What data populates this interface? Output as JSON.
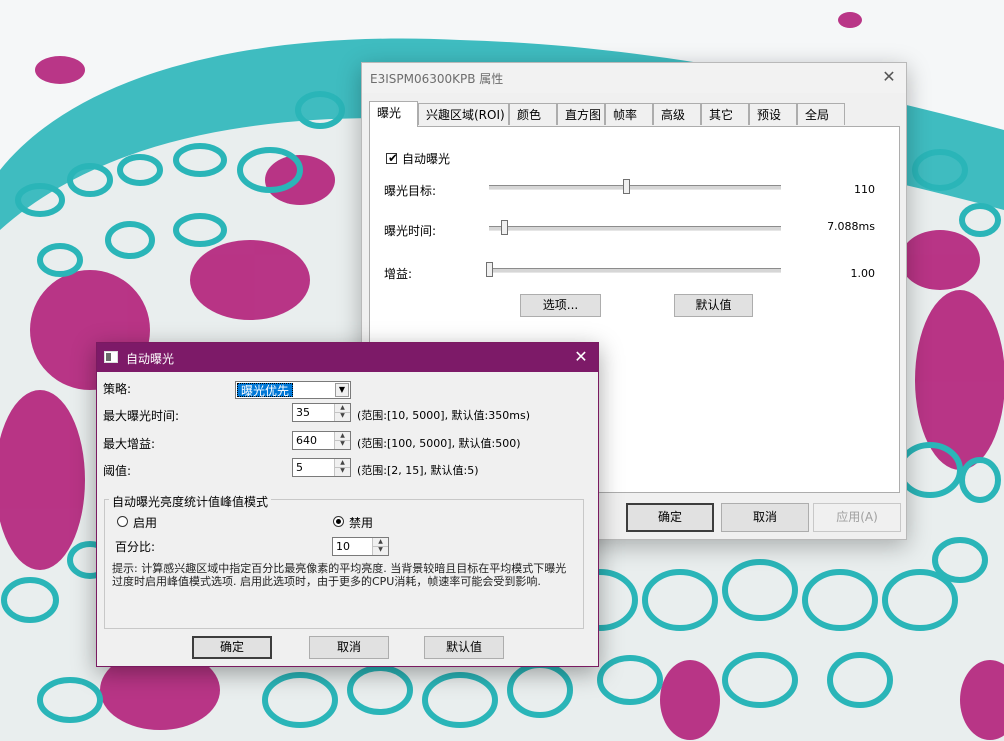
{
  "props_window": {
    "title": "E3ISPM06300KPB 属性",
    "close_glyph": "✕",
    "tabs": [
      "曝光",
      "兴趣区域(ROI)",
      "颜色",
      "直方图",
      "帧率",
      "高级",
      "其它",
      "预设",
      "全局"
    ],
    "active_tab": "曝光",
    "auto_exposure_label": "自动曝光",
    "auto_exposure_checked": true,
    "check_glyph": "✔",
    "target_label": "曝光目标:",
    "target_value": "110",
    "target_position": 0.47,
    "time_label": "曝光时间:",
    "time_value": "7.088ms",
    "time_position": 0.05,
    "gain_label": "增益:",
    "gain_value": "1.00",
    "gain_position": 0.0,
    "options_button": "选项...",
    "defaults_button": "默认值",
    "ok_button": "确定",
    "cancel_button": "取消",
    "apply_button": "应用(A)"
  },
  "ae_dialog": {
    "title": "自动曝光",
    "close_glyph": "✕",
    "strategy_label": "策略:",
    "strategy_value": "曝光优先",
    "max_time_label": "最大曝光时间:",
    "max_time_value": "35",
    "max_time_hint": "(范围:[10, 5000], 默认值:350ms)",
    "max_gain_label": "最大增益:",
    "max_gain_value": "640",
    "max_gain_hint": "(范围:[100, 5000], 默认值:500)",
    "threshold_label": "阈值:",
    "threshold_value": "5",
    "threshold_hint": "(范围:[2, 15], 默认值:5)",
    "group_title": "自动曝光亮度统计值峰值模式",
    "enable_label": "启用",
    "disable_label": "禁用",
    "selected_mode": "禁用",
    "percent_label": "百分比:",
    "percent_value": "10",
    "tip": "提示: 计算感兴趣区域中指定百分比最亮像素的平均亮度. 当背景较暗且目标在平均模式下曝光过度时启用峰值模式选项. 启用此选项时，由于更多的CPU消耗，帧速率可能会受到影响.",
    "ok_button": "确定",
    "cancel_button": "取消",
    "defaults_button": "默认值"
  },
  "icons": {
    "spin_up": "▲",
    "spin_down": "▼",
    "combo_arrow": "▼"
  },
  "colors": {
    "ae_titlebar": "#7d1a68",
    "selection": "#0078d7",
    "background_magenta": "#b01e78",
    "background_cyan": "#2ab5b8"
  }
}
